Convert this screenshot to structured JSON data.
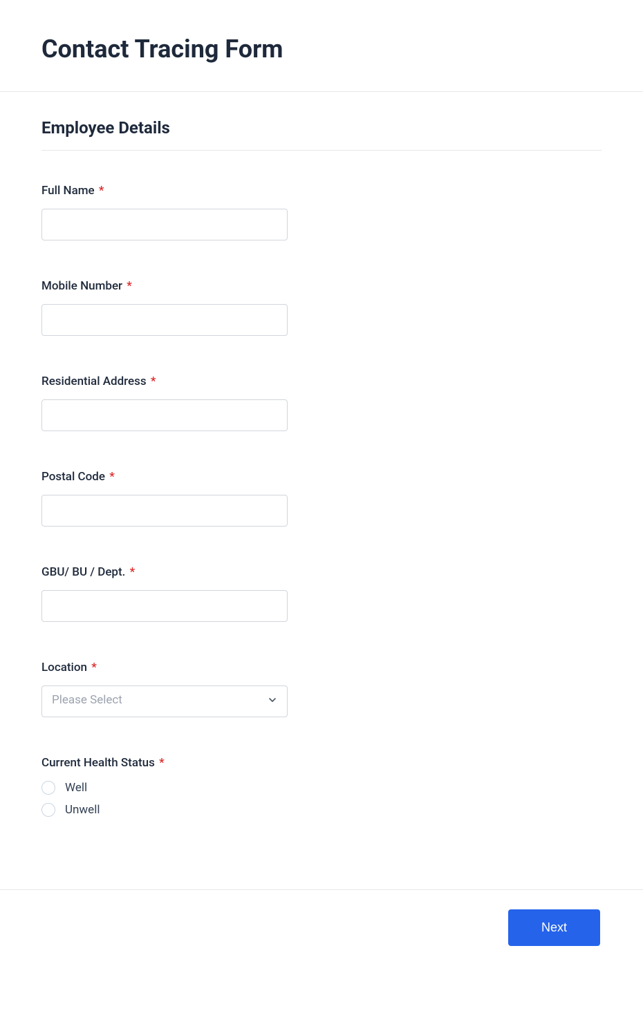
{
  "header": {
    "title": "Contact Tracing Form"
  },
  "section": {
    "title": "Employee Details"
  },
  "fields": {
    "full_name": {
      "label": "Full Name",
      "required": "*"
    },
    "mobile_number": {
      "label": "Mobile Number",
      "required": "*"
    },
    "residential_address": {
      "label": "Residential Address",
      "required": "*"
    },
    "postal_code": {
      "label": "Postal Code",
      "required": "*"
    },
    "dept": {
      "label": "GBU/ BU / Dept.",
      "required": "*"
    },
    "location": {
      "label": "Location",
      "required": "*",
      "placeholder": "Please Select"
    },
    "health_status": {
      "label": "Current Health Status",
      "required": "*",
      "options": {
        "well": "Well",
        "unwell": "Unwell"
      }
    }
  },
  "footer": {
    "next_label": "Next"
  }
}
